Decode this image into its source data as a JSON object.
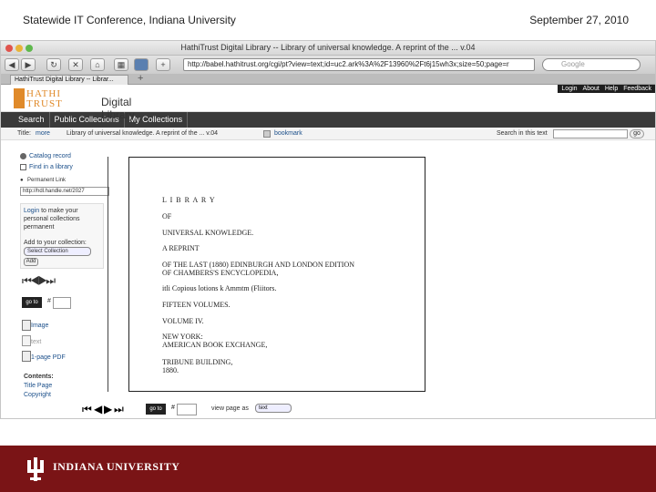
{
  "slide": {
    "title": "Statewide IT Conference, Indiana University",
    "date": "September 27, 2010"
  },
  "browser": {
    "window_title": "HathiTrust Digital Library -- Library of universal knowledge. A reprint of the ... v.04",
    "url": "http://babel.hathitrust.org/cgi/pt?view=text;id=uc2.ark%3A%2F13960%2Ft6j15wh3x;size=50;page=r",
    "search_placeholder": "Google",
    "tab_label": "HathiTrust Digital Library -- Librar...",
    "back_icon": "back-arrow-icon",
    "forward_icon": "forward-arrow-icon",
    "reload_icon": "reload-icon"
  },
  "hathi": {
    "logo_line1": "HATHI",
    "logo_line2": "TRUST",
    "site_name": "Digital Library",
    "top_links": [
      "Login",
      "About",
      "Help",
      "Feedback"
    ],
    "nav": [
      "Search",
      "Public Collections",
      "My Collections"
    ],
    "title_label": "Title:",
    "title_more": "more",
    "title_text": "Library of universal knowledge. A reprint of the ... v.04",
    "bookmark": "bookmark",
    "search_text_label": "Search in this text",
    "search_go": "go"
  },
  "sidebar": {
    "catalog_record": "Catalog record",
    "find_library": "Find in a library",
    "permanent_link_label": "Permanent Link",
    "permanent_link_value": "http://hdl.handle.net/2027",
    "login_text": "Login",
    "login_rest": " to make your personal collections permanent",
    "add_collection": "Add to your collection:",
    "select_collection": "Select Collection",
    "add_button": "Add",
    "go_to": "go to",
    "hash": "#",
    "image": "Image",
    "text": "text",
    "pdf": "1-page PDF",
    "contents": "Contents:",
    "title_page": "Title Page",
    "copyright": "Copyright"
  },
  "page_text": [
    "L I B R A R Y",
    "OF",
    "UNIVERSAL KNOWLEDGE.",
    "A REPRINT",
    "OF THE LAST (1880) EDINBURGH AND LONDON EDITION",
    "OF CHAMBERS'S ENCYCLOPEDIA,",
    "itli Copious lotions k Ammtm (Fliitors.",
    "FIFTEEN VOLUMES.",
    "VOLUME IV.",
    "NEW YORK:",
    "AMERICAN BOOK EXCHANGE,",
    "TRIBUNE BUILDING,",
    "1880."
  ],
  "bottom_nav": {
    "go_to": "go to",
    "hash": "#",
    "view_page_as": "view page as",
    "view_mode": "text"
  },
  "footer": {
    "university": "INDIANA UNIVERSITY",
    "color": "#7a1416"
  }
}
